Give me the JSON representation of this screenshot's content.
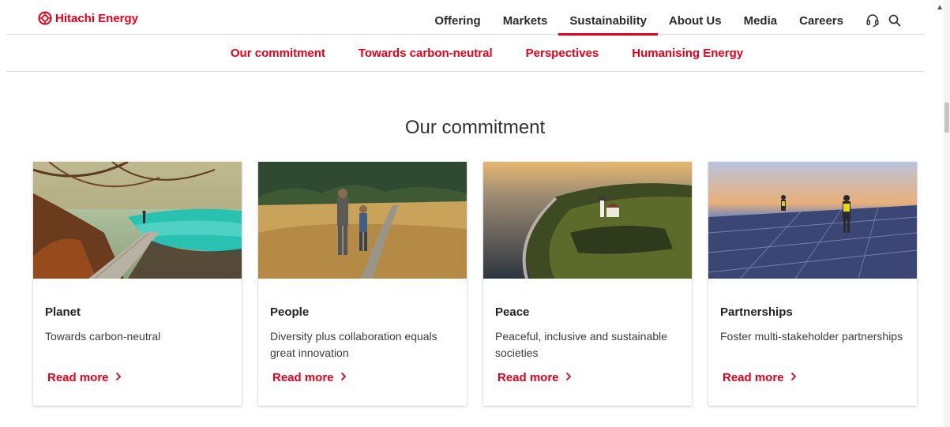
{
  "header": {
    "brand": "Hitachi Energy",
    "nav": [
      "Offering",
      "Markets",
      "Sustainability",
      "About Us",
      "Media",
      "Careers"
    ],
    "active_nav": "Sustainability",
    "icons": [
      "support-headset-icon",
      "search-icon"
    ]
  },
  "subnav": [
    "Our commitment",
    "Towards carbon-neutral",
    "Perspectives",
    "Humanising Energy"
  ],
  "main": {
    "title": "Our commitment",
    "cards": [
      {
        "title": "Planet",
        "description": "Towards carbon-neutral",
        "link": "Read more"
      },
      {
        "title": "People",
        "description": "Diversity plus collaboration equals great innovation",
        "link": "Read more"
      },
      {
        "title": "Peace",
        "description": "Peaceful, inclusive and sustainable societies",
        "link": "Read more"
      },
      {
        "title": "Partnerships",
        "description": "Foster multi-stakeholder partnerships",
        "link": "Read more"
      }
    ]
  },
  "colors": {
    "brand": "#e2001a",
    "text": "#1f1f1f",
    "border": "#dcdcdc"
  }
}
